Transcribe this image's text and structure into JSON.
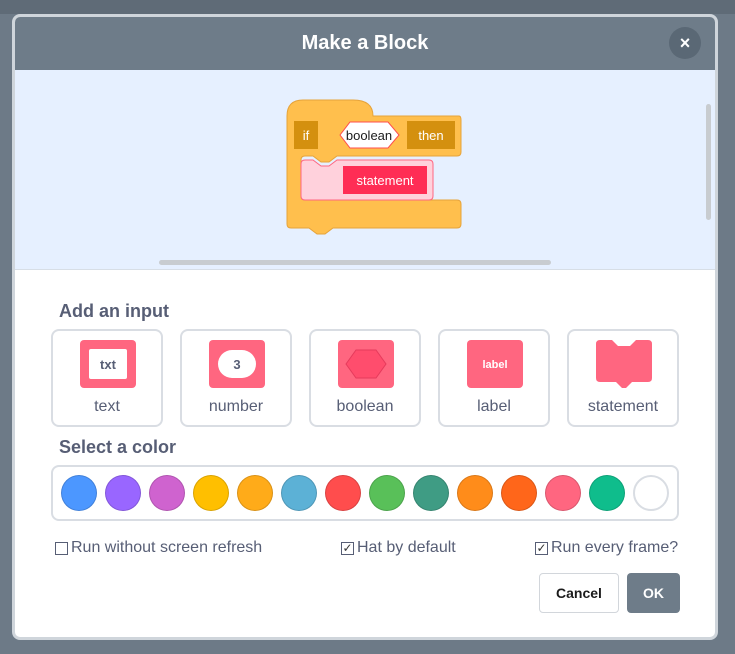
{
  "dialog": {
    "title": "Make a Block",
    "close_label": "×"
  },
  "preview": {
    "if_text": "if",
    "boolean_text": "boolean",
    "then_text": "then",
    "statement_text": "statement"
  },
  "inputs": {
    "heading": "Add an input",
    "items": [
      {
        "label": "text",
        "icon_text": "txt",
        "icon": "text-input-icon"
      },
      {
        "label": "number",
        "icon_text": "3",
        "icon": "number-input-icon"
      },
      {
        "label": "boolean",
        "icon": "boolean-input-icon"
      },
      {
        "label": "label",
        "icon_text": "label",
        "icon": "label-input-icon"
      },
      {
        "label": "statement",
        "icon": "statement-input-icon"
      }
    ]
  },
  "colors": {
    "heading": "Select a color",
    "swatches": [
      "#4c97ff",
      "#9966ff",
      "#cf63cf",
      "#ffbf00",
      "#ffab19",
      "#5cb1d6",
      "#ff4d4d",
      "#59c059",
      "#3f9c84",
      "#ff8c1a",
      "#ff661a",
      "#ff6680",
      "#0fbd8c",
      "#ffffff"
    ]
  },
  "options": {
    "no_refresh": {
      "label": "Run without screen refresh",
      "checked": false
    },
    "hat": {
      "label": "Hat by default",
      "checked": true
    },
    "every_frame": {
      "label": "Run every frame?",
      "checked": true
    }
  },
  "buttons": {
    "cancel": "Cancel",
    "ok": "OK"
  },
  "theme": {
    "header": "#6e7c89",
    "block_fill": "#ffbf4d",
    "block_stroke": "#e6a33a",
    "label_fill": "#d4900f",
    "input_pink": "#ff6680",
    "text": "#575e75"
  }
}
